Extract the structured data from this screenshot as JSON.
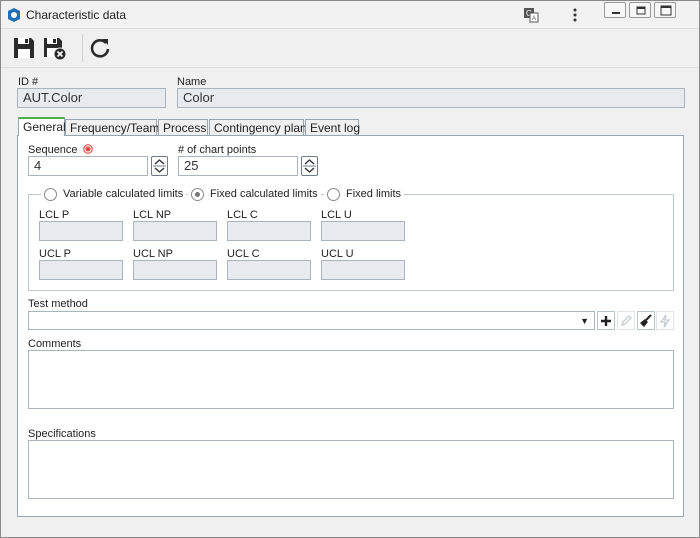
{
  "window": {
    "title": "Characteristic data"
  },
  "header": {
    "id_label": "ID #",
    "id_value": "AUT.Color",
    "name_label": "Name",
    "name_value": "Color"
  },
  "tabs": [
    {
      "label": "General"
    },
    {
      "label": "Frequency/Team"
    },
    {
      "label": "Process"
    },
    {
      "label": "Contingency plan"
    },
    {
      "label": "Event log"
    }
  ],
  "general": {
    "sequence_label": "Sequence",
    "sequence_value": "4",
    "chart_points_label": "# of chart points",
    "chart_points_value": "25",
    "limit_modes": [
      {
        "label": "Variable calculated limits",
        "checked": false
      },
      {
        "label": "Fixed calculated limits",
        "checked": true
      },
      {
        "label": "Fixed limits",
        "checked": false
      }
    ],
    "lcl_p": "LCL P",
    "lcl_np": "LCL NP",
    "lcl_c": "LCL C",
    "lcl_u": "LCL U",
    "ucl_p": "UCL P",
    "ucl_np": "UCL NP",
    "ucl_c": "UCL C",
    "ucl_u": "UCL U",
    "test_method_label": "Test method",
    "test_method_value": "",
    "comments_label": "Comments",
    "specifications_label": "Specifications"
  },
  "colors": {
    "required": "#e53935",
    "active_tab": "#4caf50",
    "app_blue": "#1e6fb8"
  }
}
